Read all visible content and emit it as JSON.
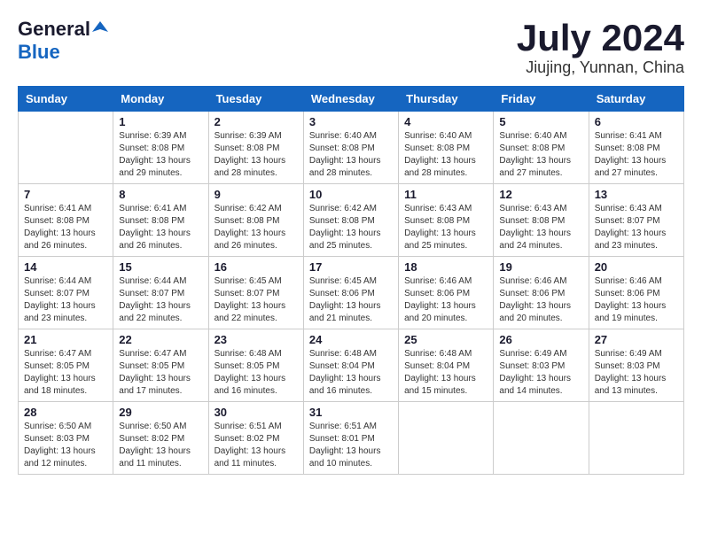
{
  "header": {
    "logo_general": "General",
    "logo_blue": "Blue",
    "month_title": "July 2024",
    "location": "Jiujing, Yunnan, China"
  },
  "weekdays": [
    "Sunday",
    "Monday",
    "Tuesday",
    "Wednesday",
    "Thursday",
    "Friday",
    "Saturday"
  ],
  "weeks": [
    [
      {
        "day": "",
        "info": ""
      },
      {
        "day": "1",
        "info": "Sunrise: 6:39 AM\nSunset: 8:08 PM\nDaylight: 13 hours\nand 29 minutes."
      },
      {
        "day": "2",
        "info": "Sunrise: 6:39 AM\nSunset: 8:08 PM\nDaylight: 13 hours\nand 28 minutes."
      },
      {
        "day": "3",
        "info": "Sunrise: 6:40 AM\nSunset: 8:08 PM\nDaylight: 13 hours\nand 28 minutes."
      },
      {
        "day": "4",
        "info": "Sunrise: 6:40 AM\nSunset: 8:08 PM\nDaylight: 13 hours\nand 28 minutes."
      },
      {
        "day": "5",
        "info": "Sunrise: 6:40 AM\nSunset: 8:08 PM\nDaylight: 13 hours\nand 27 minutes."
      },
      {
        "day": "6",
        "info": "Sunrise: 6:41 AM\nSunset: 8:08 PM\nDaylight: 13 hours\nand 27 minutes."
      }
    ],
    [
      {
        "day": "7",
        "info": "Sunrise: 6:41 AM\nSunset: 8:08 PM\nDaylight: 13 hours\nand 26 minutes."
      },
      {
        "day": "8",
        "info": "Sunrise: 6:41 AM\nSunset: 8:08 PM\nDaylight: 13 hours\nand 26 minutes."
      },
      {
        "day": "9",
        "info": "Sunrise: 6:42 AM\nSunset: 8:08 PM\nDaylight: 13 hours\nand 26 minutes."
      },
      {
        "day": "10",
        "info": "Sunrise: 6:42 AM\nSunset: 8:08 PM\nDaylight: 13 hours\nand 25 minutes."
      },
      {
        "day": "11",
        "info": "Sunrise: 6:43 AM\nSunset: 8:08 PM\nDaylight: 13 hours\nand 25 minutes."
      },
      {
        "day": "12",
        "info": "Sunrise: 6:43 AM\nSunset: 8:08 PM\nDaylight: 13 hours\nand 24 minutes."
      },
      {
        "day": "13",
        "info": "Sunrise: 6:43 AM\nSunset: 8:07 PM\nDaylight: 13 hours\nand 23 minutes."
      }
    ],
    [
      {
        "day": "14",
        "info": "Sunrise: 6:44 AM\nSunset: 8:07 PM\nDaylight: 13 hours\nand 23 minutes."
      },
      {
        "day": "15",
        "info": "Sunrise: 6:44 AM\nSunset: 8:07 PM\nDaylight: 13 hours\nand 22 minutes."
      },
      {
        "day": "16",
        "info": "Sunrise: 6:45 AM\nSunset: 8:07 PM\nDaylight: 13 hours\nand 22 minutes."
      },
      {
        "day": "17",
        "info": "Sunrise: 6:45 AM\nSunset: 8:06 PM\nDaylight: 13 hours\nand 21 minutes."
      },
      {
        "day": "18",
        "info": "Sunrise: 6:46 AM\nSunset: 8:06 PM\nDaylight: 13 hours\nand 20 minutes."
      },
      {
        "day": "19",
        "info": "Sunrise: 6:46 AM\nSunset: 8:06 PM\nDaylight: 13 hours\nand 20 minutes."
      },
      {
        "day": "20",
        "info": "Sunrise: 6:46 AM\nSunset: 8:06 PM\nDaylight: 13 hours\nand 19 minutes."
      }
    ],
    [
      {
        "day": "21",
        "info": "Sunrise: 6:47 AM\nSunset: 8:05 PM\nDaylight: 13 hours\nand 18 minutes."
      },
      {
        "day": "22",
        "info": "Sunrise: 6:47 AM\nSunset: 8:05 PM\nDaylight: 13 hours\nand 17 minutes."
      },
      {
        "day": "23",
        "info": "Sunrise: 6:48 AM\nSunset: 8:05 PM\nDaylight: 13 hours\nand 16 minutes."
      },
      {
        "day": "24",
        "info": "Sunrise: 6:48 AM\nSunset: 8:04 PM\nDaylight: 13 hours\nand 16 minutes."
      },
      {
        "day": "25",
        "info": "Sunrise: 6:48 AM\nSunset: 8:04 PM\nDaylight: 13 hours\nand 15 minutes."
      },
      {
        "day": "26",
        "info": "Sunrise: 6:49 AM\nSunset: 8:03 PM\nDaylight: 13 hours\nand 14 minutes."
      },
      {
        "day": "27",
        "info": "Sunrise: 6:49 AM\nSunset: 8:03 PM\nDaylight: 13 hours\nand 13 minutes."
      }
    ],
    [
      {
        "day": "28",
        "info": "Sunrise: 6:50 AM\nSunset: 8:03 PM\nDaylight: 13 hours\nand 12 minutes."
      },
      {
        "day": "29",
        "info": "Sunrise: 6:50 AM\nSunset: 8:02 PM\nDaylight: 13 hours\nand 11 minutes."
      },
      {
        "day": "30",
        "info": "Sunrise: 6:51 AM\nSunset: 8:02 PM\nDaylight: 13 hours\nand 11 minutes."
      },
      {
        "day": "31",
        "info": "Sunrise: 6:51 AM\nSunset: 8:01 PM\nDaylight: 13 hours\nand 10 minutes."
      },
      {
        "day": "",
        "info": ""
      },
      {
        "day": "",
        "info": ""
      },
      {
        "day": "",
        "info": ""
      }
    ]
  ]
}
